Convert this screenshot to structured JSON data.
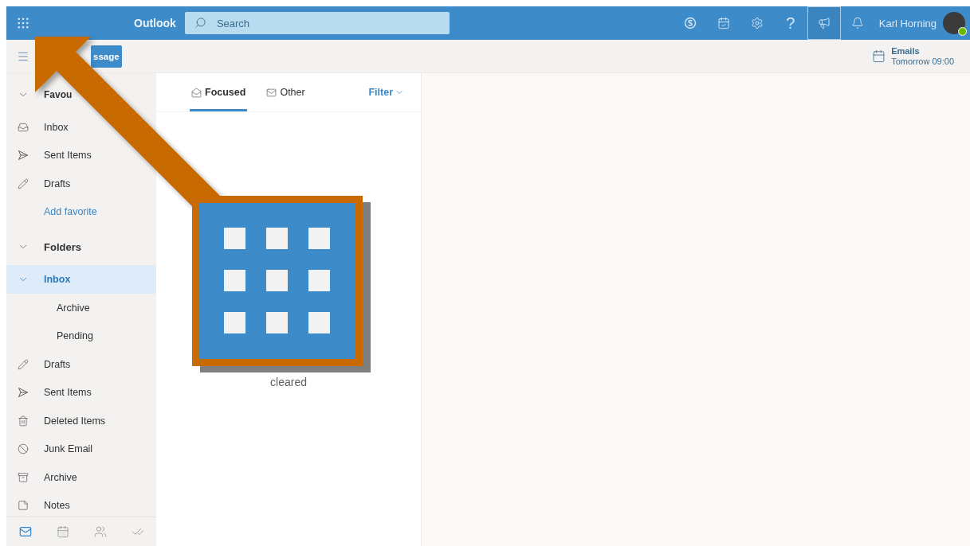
{
  "header": {
    "app_name": "Outlook",
    "search": {
      "placeholder": "Search"
    },
    "actions": [
      {
        "kind": "skype",
        "selected": false
      },
      {
        "kind": "calendar-check",
        "selected": false
      },
      {
        "kind": "settings",
        "selected": false
      },
      {
        "kind": "help",
        "glyph": "?",
        "selected": false
      },
      {
        "kind": "feedback",
        "selected": true
      },
      {
        "kind": "notifications",
        "selected": false
      }
    ],
    "user": {
      "name": "Karl Horning",
      "online": true
    }
  },
  "command_bar": {
    "new_message_label": "ssage",
    "reminder": {
      "title": "Emails",
      "time": "Tomorrow 09:00"
    }
  },
  "sidebar": {
    "favorites": {
      "label": "Favou",
      "expanded": true,
      "items": [
        {
          "kind": "inbox",
          "label": "Inbox",
          "selected": false
        },
        {
          "kind": "sent",
          "label": "Sent Items",
          "selected": false
        },
        {
          "kind": "drafts",
          "label": "Drafts",
          "selected": false
        }
      ],
      "add_link": "Add favorite"
    },
    "folders": {
      "label": "Folders",
      "expanded": true,
      "items": [
        {
          "label": "Inbox",
          "selected": true,
          "expanded": true,
          "children": [
            {
              "label": "Archive",
              "selected": false
            },
            {
              "label": "Pending",
              "selected": false
            }
          ]
        },
        {
          "kind": "drafts",
          "label": "Drafts",
          "selected": false
        },
        {
          "kind": "sent",
          "label": "Sent Items",
          "selected": false
        },
        {
          "kind": "deleted",
          "label": "Deleted Items",
          "selected": false
        },
        {
          "kind": "junk",
          "label": "Junk Email",
          "selected": false
        },
        {
          "kind": "archive",
          "label": "Archive",
          "selected": false
        },
        {
          "kind": "notes",
          "label": "Notes",
          "selected": false
        }
      ]
    },
    "nav": [
      {
        "kind": "mail",
        "selected": true
      },
      {
        "kind": "calendar",
        "selected": false
      },
      {
        "kind": "people",
        "selected": false
      },
      {
        "kind": "tasks",
        "selected": false
      }
    ]
  },
  "message_list": {
    "tabs": [
      {
        "kind": "focused",
        "label": "Focused",
        "selected": true
      },
      {
        "kind": "other",
        "label": "Other",
        "selected": false
      }
    ],
    "filter": "Filter",
    "empty_message": "cleared"
  },
  "overlay": {
    "kind": "arrow-to-launcher"
  }
}
